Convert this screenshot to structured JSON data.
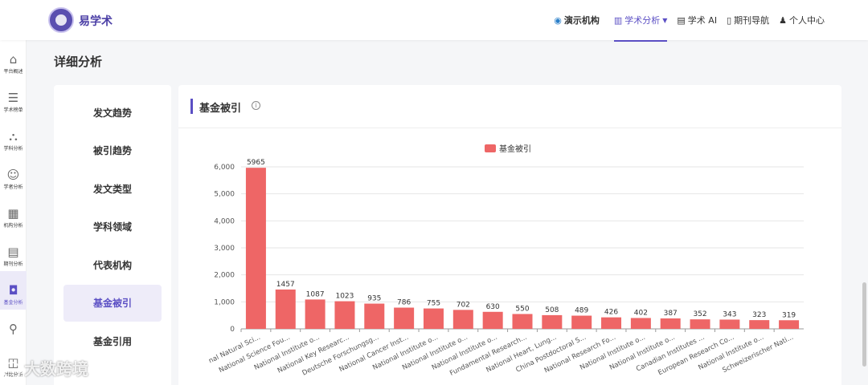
{
  "header": {
    "brand": "易学术",
    "nav": [
      {
        "label": "演示机构",
        "icon": "org-icon"
      },
      {
        "label": "学术分析",
        "icon": "chart-icon",
        "active": true
      },
      {
        "label": "学术 AI",
        "icon": "ai-icon"
      },
      {
        "label": "期刊导航",
        "icon": "journal-icon"
      },
      {
        "label": "个人中心",
        "icon": "user-icon"
      }
    ]
  },
  "sidebar": {
    "items": [
      {
        "label": "平台概述",
        "icon": "home-icon"
      },
      {
        "label": "学术榜单",
        "icon": "list-icon"
      },
      {
        "label": "学科分析",
        "icon": "hierarchy-icon"
      },
      {
        "label": "学者分析",
        "icon": "people-icon"
      },
      {
        "label": "机构分析",
        "icon": "building-icon"
      },
      {
        "label": "期刊分析",
        "icon": "document-icon"
      },
      {
        "label": "基金分析",
        "icon": "fund-icon",
        "active": true
      },
      {
        "label": "",
        "icon": "location-icon"
      },
      {
        "label": "对比分析",
        "icon": "compare-icon"
      }
    ]
  },
  "page_title": "详细分析",
  "submenu": {
    "items": [
      "发文趋势",
      "被引趋势",
      "发文类型",
      "学科领域",
      "代表机构",
      "基金被引",
      "基金引用"
    ],
    "active_index": 5
  },
  "panel": {
    "title": "基金被引"
  },
  "watermark": "大数跨境",
  "chart_data": {
    "type": "bar",
    "legend": [
      "基金被引"
    ],
    "color": "#ee6666",
    "ylim": [
      0,
      6000
    ],
    "yticks": [
      "0",
      "1,000",
      "2,000",
      "3,000",
      "4,000",
      "5,000",
      "6,000"
    ],
    "categories": [
      "nal Natural Sci...",
      "National Science Fou...",
      "National Institute o...",
      "National Key Researc...",
      "Deutsche Forschungsg...",
      "National Cancer Inst...",
      "National Institute o...",
      "National Institute o...",
      "National Institute o...",
      "Fundamental Research...",
      "National Heart, Lung...",
      "China Postdoctoral S...",
      "National Research Fo...",
      "National Institute o...",
      "National Institute o...",
      "Canadian Institutes ...",
      "European Research Co...",
      "National Institute o...",
      "Schweizerischer Nati..."
    ],
    "series": [
      {
        "name": "基金被引",
        "values": [
          5965,
          1457,
          1087,
          1023,
          935,
          786,
          755,
          702,
          630,
          550,
          508,
          489,
          426,
          402,
          387,
          352,
          343,
          323,
          319
        ]
      }
    ],
    "grid": true,
    "legend_position": "top-center"
  }
}
